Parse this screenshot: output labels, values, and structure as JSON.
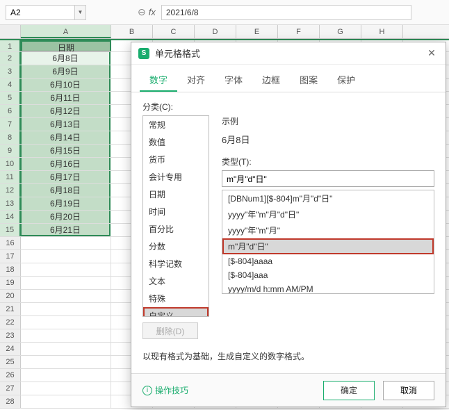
{
  "namebox": "A2",
  "formula_bar": "2021/6/8",
  "columns": [
    "A",
    "B",
    "C",
    "D",
    "E",
    "F",
    "G",
    "H"
  ],
  "data_header": "日期",
  "data_cells": [
    "6月8日",
    "6月9日",
    "6月10日",
    "6月11日",
    "6月12日",
    "6月13日",
    "6月14日",
    "6月15日",
    "6月16日",
    "6月17日",
    "6月18日",
    "6月19日",
    "6月20日",
    "6月21日"
  ],
  "dialog": {
    "title": "单元格格式",
    "tabs": [
      "数字",
      "对齐",
      "字体",
      "边框",
      "图案",
      "保护"
    ],
    "active_tab": 0,
    "category_label": "分类(C):",
    "categories": [
      "常规",
      "数值",
      "货币",
      "会计专用",
      "日期",
      "时间",
      "百分比",
      "分数",
      "科学记数",
      "文本",
      "特殊",
      "自定义"
    ],
    "selected_category": 11,
    "example_label": "示例",
    "example_value": "6月8日",
    "type_label": "类型(T):",
    "type_input": "m\"月\"d\"日\"",
    "type_options": [
      "[DBNum1][$-804]m\"月\"d\"日\"",
      "yyyy\"年\"m\"月\"d\"日\"",
      "yyyy\"年\"m\"月\"",
      "m\"月\"d\"日\"",
      "[$-804]aaaa",
      "[$-804]aaa",
      "yyyy/m/d h:mm AM/PM"
    ],
    "selected_type": 3,
    "delete_label": "删除(D)",
    "note": "以现有格式为基础，生成自定义的数字格式。",
    "tips": "操作技巧",
    "ok": "确定",
    "cancel": "取消"
  }
}
